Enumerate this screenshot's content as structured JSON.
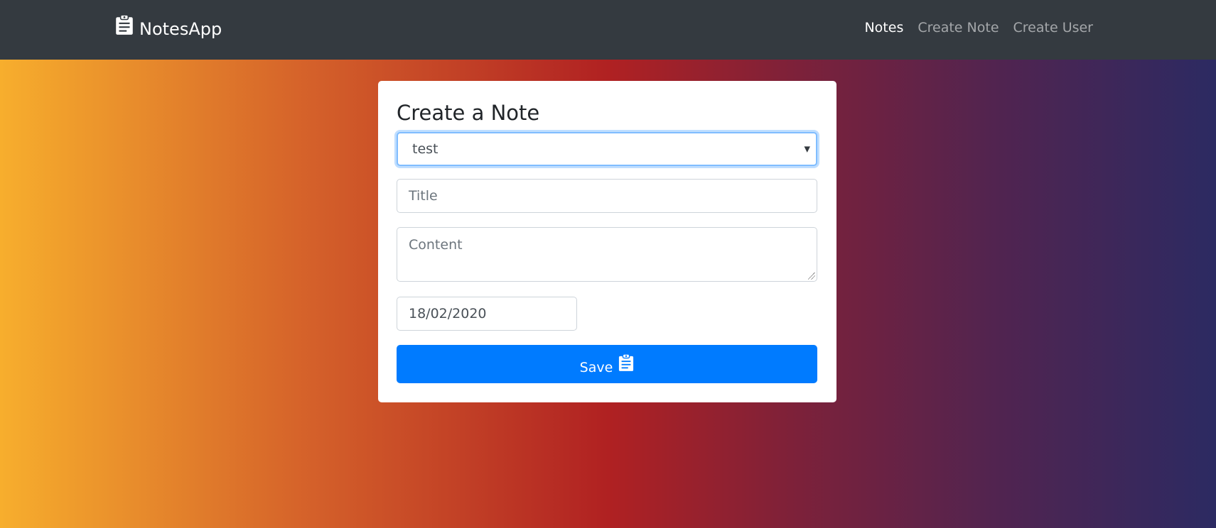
{
  "navbar": {
    "brand_icon": "clipboard-icon",
    "brand_label": "NotesApp",
    "links": [
      {
        "label": "Notes",
        "active": true
      },
      {
        "label": "Create Note",
        "active": false
      },
      {
        "label": "Create User",
        "active": false
      }
    ]
  },
  "form": {
    "title": "Create a Note",
    "user_select": {
      "value": "test"
    },
    "title_field": {
      "placeholder": "Title",
      "value": ""
    },
    "content_field": {
      "placeholder": "Content",
      "value": ""
    },
    "date_field": {
      "value": "18/02/2020"
    },
    "save_button": {
      "label": "Save",
      "icon": "clipboard-icon"
    }
  },
  "colors": {
    "navbar_bg": "#343a40",
    "primary": "#007bff"
  }
}
